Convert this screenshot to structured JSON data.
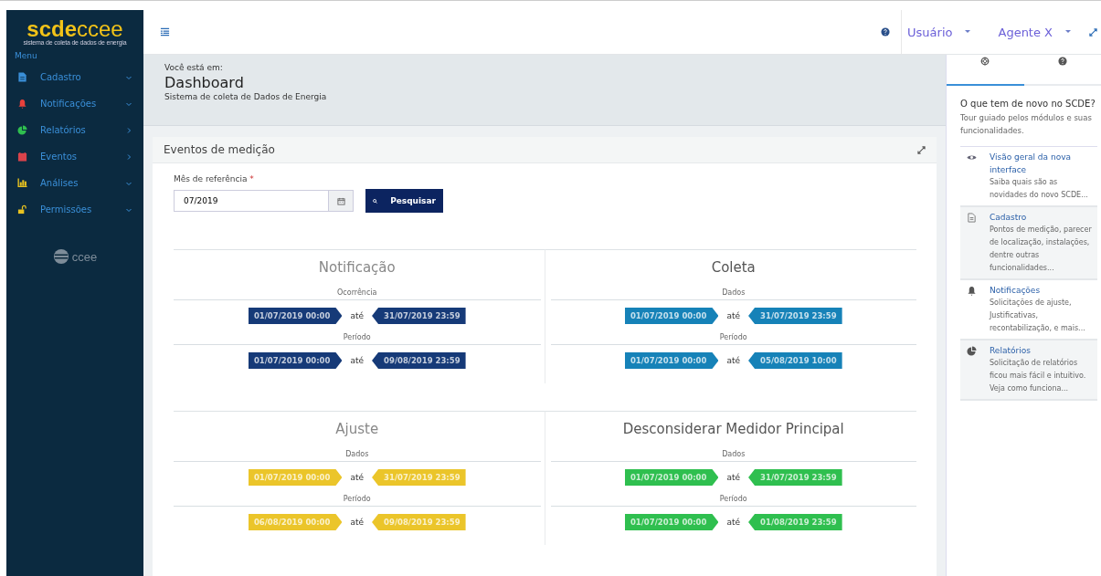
{
  "brand": {
    "logo_bold": "scde",
    "logo_light": "ccee",
    "tagline": "sistema de coleta de dados de energia",
    "menu_label": "Menu",
    "footer_logo": "ccee"
  },
  "sidebar": {
    "items": [
      {
        "label": "Cadastro",
        "kind": "document",
        "color": "#3a8fd8",
        "expanded": true
      },
      {
        "label": "Notificações",
        "kind": "bell",
        "color": "#e8413c",
        "expanded": true
      },
      {
        "label": "Relatórios",
        "kind": "pie",
        "color": "#2fbf4f",
        "expanded": false
      },
      {
        "label": "Eventos",
        "kind": "calendar",
        "color": "#d9434b",
        "expanded": false
      },
      {
        "label": "Análises",
        "kind": "bars",
        "color": "#e8c220",
        "expanded": true
      },
      {
        "label": "Permissões",
        "kind": "lock",
        "color": "#e8c220",
        "expanded": true
      }
    ]
  },
  "topbar": {
    "user": "Usuário",
    "agent": "Agente X"
  },
  "breadcrumb": {
    "prefix": "Você está em:",
    "title": "Dashboard",
    "subtitle": "Sistema de coleta de Dados de Energia"
  },
  "panel": {
    "title": "Eventos de medição",
    "field_label": "Mês de referência",
    "required_mark": "*",
    "value": "07/2019",
    "search_button": "Pesquisar",
    "sections": [
      {
        "title": "Notificação",
        "color": "#163a78",
        "groups": [
          {
            "label": "Ocorrência",
            "from": "01/07/2019 00:00",
            "sep": "até",
            "to": "31/07/2019 23:59"
          },
          {
            "label": "Período",
            "from": "01/07/2019 00:00",
            "sep": "até",
            "to": "09/08/2019 23:59"
          }
        ]
      },
      {
        "title": "Coleta",
        "color": "#1682b8",
        "groups": [
          {
            "label": "Dados",
            "from": "01/07/2019 00:00",
            "sep": "até",
            "to": "31/07/2019 23:59"
          },
          {
            "label": "Período",
            "from": "01/07/2019 00:00",
            "sep": "até",
            "to": "05/08/2019 10:00"
          }
        ]
      },
      {
        "title": "Ajuste",
        "color": "#ebc52a",
        "groups": [
          {
            "label": "Dados",
            "from": "01/07/2019 00:00",
            "sep": "até",
            "to": "31/07/2019 23:59"
          },
          {
            "label": "Período",
            "from": "06/08/2019 00:00",
            "sep": "até",
            "to": "09/08/2019 23:59"
          }
        ]
      },
      {
        "title": "Desconsiderar Medidor Principal",
        "color": "#2fbf4f",
        "groups": [
          {
            "label": "Dados",
            "from": "01/07/2019 00:00",
            "sep": "até",
            "to": "31/07/2019 23:59"
          },
          {
            "label": "Período",
            "from": "01/07/2019 00:00",
            "sep": "até",
            "to": "01/08/2019 23:59"
          }
        ]
      }
    ]
  },
  "help": {
    "tabs": [
      {
        "kind": "lifebuoy",
        "selected": true
      },
      {
        "kind": "question",
        "selected": false
      }
    ],
    "title": "O que tem de novo no SCDE?",
    "subtitle": "Tour guiado pelos módulos e suas funcionalidades.",
    "items": [
      {
        "kind": "eye",
        "title": "Visão geral da nova interface",
        "text": "Saiba quais são as novidades do novo SCDE..."
      },
      {
        "kind": "document",
        "title": "Cadastro",
        "text": "Pontos de medição, parecer de localização, instalações, dentre outras funcionalidades..."
      },
      {
        "kind": "bell",
        "title": "Notificações",
        "text": "Solicitações de ajuste, Justificativas, recontabilização, e mais..."
      },
      {
        "kind": "pie",
        "title": "Relatórios",
        "text": "Solicitação de relatórios ficou mais fácil e intuitivo. Veja como funciona..."
      }
    ]
  }
}
